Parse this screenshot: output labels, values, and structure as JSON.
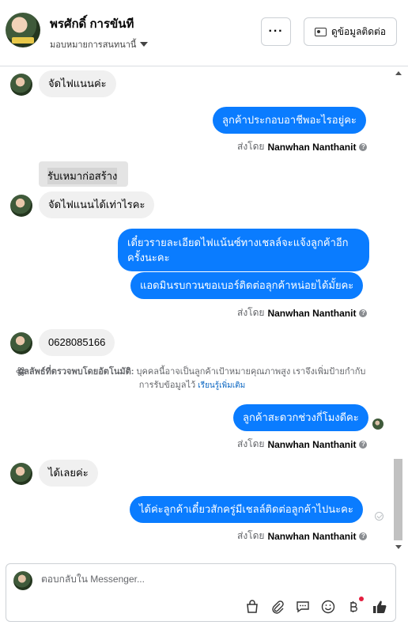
{
  "header": {
    "name": "พรศักดิ์ การขันที",
    "assign_label": "มอบหมายการสนทนานี้",
    "more_label": "···",
    "contact_label": "ดูข้อมูลติดต่อ"
  },
  "messages": {
    "m1": "จัดไฟแนนค่ะ",
    "m2": "ลูกค้าประกอบอาชีพอะไรอยู่คะ",
    "m3": "รับเหมาก่อสร้าง",
    "m4": "จัดไฟแนนได้เท่าไรคะ",
    "m5": "เดี๋ยวรายละเอียดไฟแน้นซ์ทางเชลล์จะแจ้งลูกค้าอีกครั้งนะคะ",
    "m6": "แอดมินรบกวนขอเบอร์ติดต่อลุกค้าหน่อยได้มั้ยคะ",
    "m7": "0628085166",
    "m8": "ลูกค้าสะดวกช่วงกี่โมงดีคะ",
    "m9": "ได้เลยค่ะ",
    "m10": "ได้ค่ะลูกค้าเดี๋ยวสักครู่มีเชลล์ติดต่อลูกค้าไปนะคะ"
  },
  "sent_by": {
    "prefix": "ส่งโดย",
    "agent": "Nanwhan Nanthanit"
  },
  "ai_note": {
    "title": "ผลลัพธ์ที่ตรวจพบโดยอัตโนมัติ:",
    "body": "บุคคลนี้อาจเป็นลูกค้าเป้าหมายคุณภาพสูง เราจึงเพิ่มป้ายกำกับการรับข้อมูลไว้",
    "link": "เรียนรู้เพิ่มเติม"
  },
  "composer": {
    "placeholder": "ตอบกลับใน Messenger..."
  },
  "colors": {
    "outgoing_bubble": "#0a7cff",
    "incoming_bubble": "#f0f0f0",
    "link": "#0a66c2",
    "notification_dot": "#e41e3f"
  },
  "icons": {
    "tools": [
      "shopping-bag-icon",
      "paperclip-icon",
      "saved-reply-icon",
      "emoji-icon",
      "baht-payment-icon",
      "thumbs-up-icon"
    ]
  }
}
